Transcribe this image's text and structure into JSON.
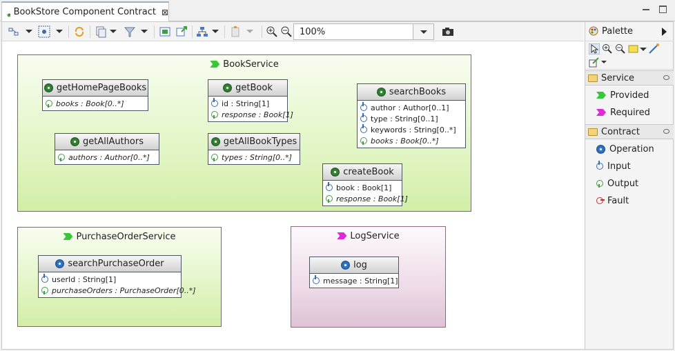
{
  "editor": {
    "tab_title": "BookStore Component Contract",
    "close_glyph": "⊠"
  },
  "toolbar": {
    "zoom_value": "100%",
    "icons": [
      "diagram-select-icon",
      "arrange-all-icon",
      "refresh-icon",
      "copy-format-icon",
      "filter-icon",
      "show-all-icon",
      "export-icon",
      "layout-icon",
      "paste-icon",
      "zoom-in-icon",
      "zoom-out-icon",
      "camera-icon"
    ]
  },
  "canvas": {
    "services": [
      {
        "name": "BookService",
        "kind": "provided",
        "operations": [
          {
            "name": "getHomePageBooks",
            "params": [
              {
                "dir": "out",
                "text": "books : Book[0..*]"
              }
            ]
          },
          {
            "name": "getBook",
            "params": [
              {
                "dir": "in",
                "text": "id : String[1]"
              },
              {
                "dir": "out",
                "text": "response : Book[1]"
              }
            ]
          },
          {
            "name": "searchBooks",
            "params": [
              {
                "dir": "in",
                "text": "author : Author[0..1]"
              },
              {
                "dir": "in",
                "text": "type : String[0..1]"
              },
              {
                "dir": "in",
                "text": "keywords : String[0..*]"
              },
              {
                "dir": "out",
                "text": "books : Book[0..*]"
              }
            ]
          },
          {
            "name": "getAllAuthors",
            "params": [
              {
                "dir": "out",
                "text": "authors : Author[0..*]"
              }
            ]
          },
          {
            "name": "getAllBookTypes",
            "params": [
              {
                "dir": "out",
                "text": "types : String[0..*]"
              }
            ]
          },
          {
            "name": "createBook",
            "params": [
              {
                "dir": "in",
                "text": "book : Book[1]"
              },
              {
                "dir": "out",
                "text": "response : Book[1]"
              }
            ]
          }
        ]
      },
      {
        "name": "PurchaseOrderService",
        "kind": "provided",
        "operations": [
          {
            "name": "searchPurchaseOrder",
            "params": [
              {
                "dir": "in",
                "text": "userId : String[1]"
              },
              {
                "dir": "out",
                "text": "purchaseOrders : PurchaseOrder[0..*]"
              }
            ]
          }
        ]
      },
      {
        "name": "LogService",
        "kind": "required",
        "operations": [
          {
            "name": "log",
            "params": [
              {
                "dir": "in",
                "text": "message : String[1]"
              }
            ]
          }
        ]
      }
    ]
  },
  "palette": {
    "title": "Palette",
    "drawers": [
      {
        "label": "Service",
        "items": [
          {
            "label": "Provided",
            "icon": "provided-arrow-icon"
          },
          {
            "label": "Required",
            "icon": "required-arrow-icon"
          }
        ]
      },
      {
        "label": "Contract",
        "items": [
          {
            "label": "Operation",
            "icon": "operation-gear-icon"
          },
          {
            "label": "Input",
            "icon": "input-icon"
          },
          {
            "label": "Output",
            "icon": "output-icon"
          },
          {
            "label": "Fault",
            "icon": "fault-icon"
          }
        ]
      }
    ]
  },
  "colors": {
    "provided": "#37c83a",
    "required": "#e02ad8",
    "service_green_bg": "#e4f6c9",
    "service_pink_bg": "#eedbe8"
  }
}
